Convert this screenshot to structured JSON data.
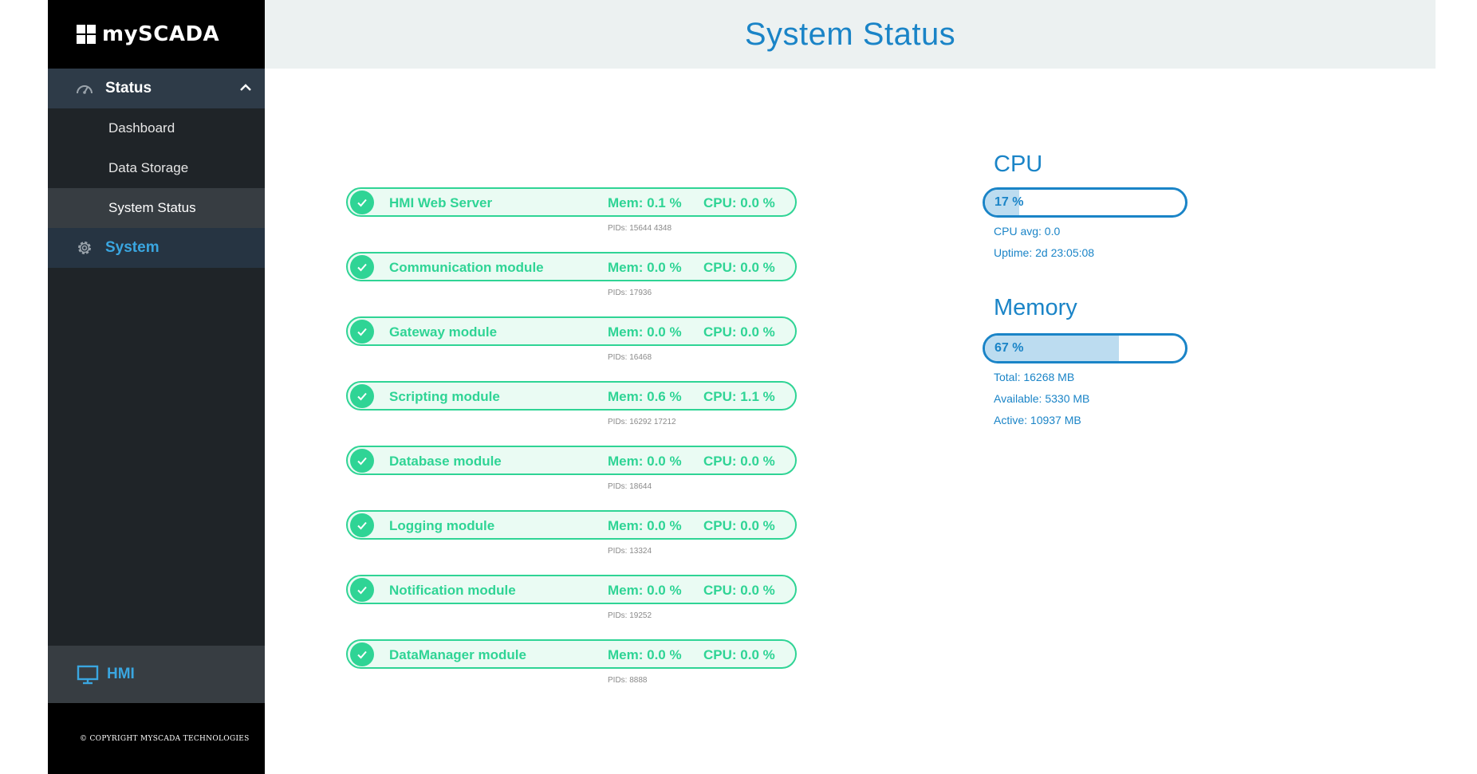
{
  "sidebar": {
    "brand": "mySCADA",
    "status_label": "Status",
    "sub_items": [
      "Dashboard",
      "Data Storage",
      "System Status"
    ],
    "active_item": "System Status",
    "system_label": "System",
    "hmi_label": "HMI",
    "copyright": "© COPYRIGHT MYSCADA TECHNOLOGIES"
  },
  "header": {
    "title": "System Status"
  },
  "modules": [
    {
      "name": "HMI Web Server",
      "mem": "Mem: 0.1 %",
      "cpu": "CPU: 0.0 %",
      "pids": "PIDs: 15644 4348"
    },
    {
      "name": "Communication module",
      "mem": "Mem: 0.0 %",
      "cpu": "CPU: 0.0 %",
      "pids": "PIDs: 17936"
    },
    {
      "name": "Gateway module",
      "mem": "Mem: 0.0 %",
      "cpu": "CPU: 0.0 %",
      "pids": "PIDs: 16468"
    },
    {
      "name": "Scripting module",
      "mem": "Mem: 0.6 %",
      "cpu": "CPU: 1.1 %",
      "pids": "PIDs: 16292 17212"
    },
    {
      "name": "Database module",
      "mem": "Mem: 0.0 %",
      "cpu": "CPU: 0.0 %",
      "pids": "PIDs: 18644"
    },
    {
      "name": "Logging module",
      "mem": "Mem: 0.0 %",
      "cpu": "CPU: 0.0 %",
      "pids": "PIDs: 13324"
    },
    {
      "name": "Notification module",
      "mem": "Mem: 0.0 %",
      "cpu": "CPU: 0.0 %",
      "pids": "PIDs: 19252"
    },
    {
      "name": "DataManager module",
      "mem": "Mem: 0.0 %",
      "cpu": "CPU: 0.0 %",
      "pids": "PIDs: 8888"
    }
  ],
  "cpu": {
    "title": "CPU",
    "value_label": "17 %",
    "percent": 17,
    "avg": "CPU avg: 0.0",
    "uptime": "Uptime: 2d 23:05:08"
  },
  "memory": {
    "title": "Memory",
    "value_label": "67 %",
    "percent": 67,
    "total": "Total: 16268 MB",
    "available": "Available: 5330 MB",
    "active": "Active: 10937 MB"
  },
  "colors": {
    "accent": "#1a84c7",
    "ok_green": "#2fd495",
    "sidebar_bg": "#1f2428",
    "header_bg": "#ecf1f1"
  },
  "icons": {
    "status": "gauge-icon",
    "collapse": "chevron-up-icon",
    "system": "gear-icon",
    "hmi": "monitor-icon",
    "module_ok": "check-circle-icon"
  }
}
